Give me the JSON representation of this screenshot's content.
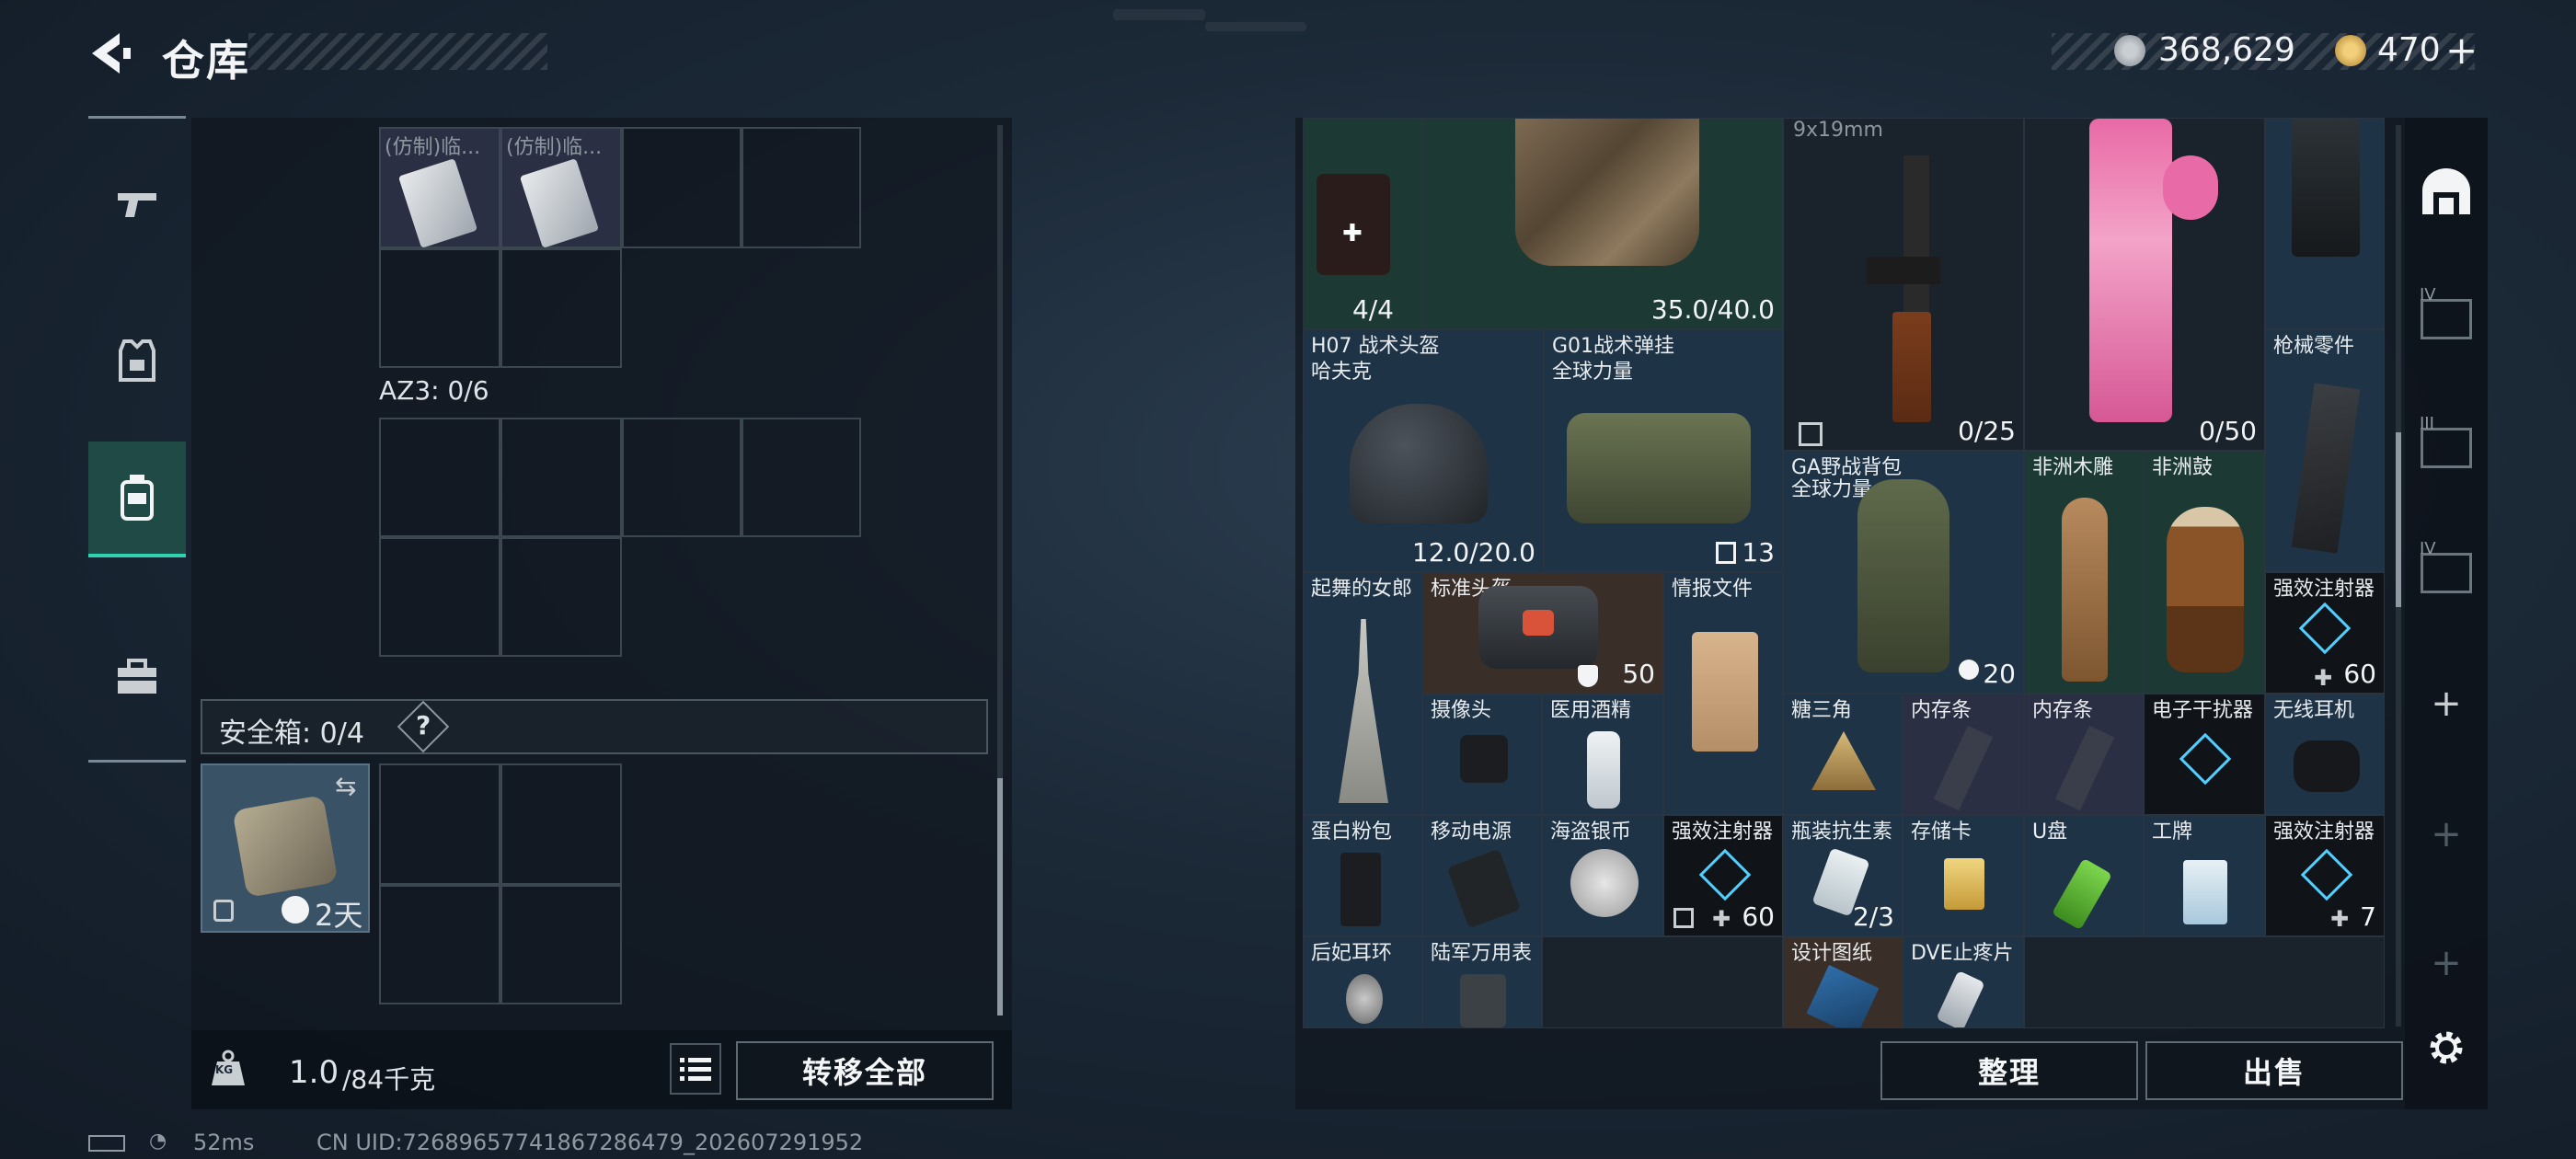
{
  "header": {
    "title": "仓库",
    "back_icon": "back-arrow-icon"
  },
  "currency": {
    "silver": "368,629",
    "gold": "470",
    "add": "+"
  },
  "rail": {
    "items": [
      {
        "icon": "gun-icon"
      },
      {
        "icon": "armor-icon"
      },
      {
        "icon": "backpack-icon"
      },
      {
        "icon": "toolbox-icon"
      }
    ]
  },
  "left": {
    "top_items": [
      {
        "label": "(仿制)临..."
      },
      {
        "label": "(仿制)临..."
      }
    ],
    "az3_label": "AZ3: 0/6",
    "safe_box": {
      "label": "安全箱: 0/4",
      "help": "?",
      "timer": "2天"
    },
    "weight": {
      "current": "1.0",
      "max": "/84千克",
      "icon_text": "KG"
    },
    "transfer_all": "转移全部"
  },
  "right": {
    "items": {
      "first_aid": {
        "value": "4/4"
      },
      "vest": {
        "value": "35.0/40.0"
      },
      "smg": {
        "caption": "9x19mm",
        "value": "0/25"
      },
      "pink_rifle": {
        "value": "0/50"
      },
      "helmet_h07": {
        "name": "H07 战术头盔",
        "sub": "哈夫克",
        "value": "12.0/20.0"
      },
      "g01_rig": {
        "name": "G01战术弹挂",
        "sub": "全球力量",
        "value": "13"
      },
      "ga_backpack": {
        "name": "GA野战背包",
        "sub": "全球力量",
        "value": "20"
      },
      "wood_carving": {
        "name": "非洲木雕"
      },
      "african_drum": {
        "name": "非洲鼓"
      },
      "gun_parts": {
        "name": "枪械零件"
      },
      "dancer": {
        "name": "起舞的女郎"
      },
      "standard_helmet": {
        "name": "标准头盔",
        "value": "50"
      },
      "intel_file": {
        "name": "情报文件"
      },
      "stim_1": {
        "name": "强效注射器",
        "value": "60"
      },
      "camera": {
        "name": "摄像头"
      },
      "alcohol": {
        "name": "医用酒精"
      },
      "sugar_triangle": {
        "name": "糖三角"
      },
      "ram_1": {
        "name": "内存条"
      },
      "ram_2": {
        "name": "内存条"
      },
      "jammer": {
        "name": "电子干扰器"
      },
      "earbuds": {
        "name": "无线耳机"
      },
      "protein": {
        "name": "蛋白粉包"
      },
      "power_bank": {
        "name": "移动电源"
      },
      "pirate_coin": {
        "name": "海盗银币"
      },
      "stim_2": {
        "name": "强效注射器",
        "value": "60"
      },
      "antibiotic": {
        "name": "瓶装抗生素",
        "value": "2/3"
      },
      "sd_card": {
        "name": "存储卡"
      },
      "usb": {
        "name": "U盘"
      },
      "badge": {
        "name": "工牌"
      },
      "stim_3": {
        "name": "强效注射器",
        "value": "7"
      },
      "earring": {
        "name": "后妃耳环"
      },
      "army_watch": {
        "name": "陆军万用表"
      },
      "blueprint": {
        "name": "设计图纸"
      },
      "dve_pill": {
        "name": "DVE止疼片"
      }
    },
    "sort_button": "整理",
    "sell_button": "出售"
  },
  "right_rail": {
    "items": [
      {
        "icon": "storage-tab-icon"
      },
      {
        "icon": "storage-iv-icon",
        "label": "IV"
      },
      {
        "icon": "storage-iii-icon",
        "label": "III"
      },
      {
        "icon": "storage-iv-folder-icon",
        "label": "IV"
      },
      {
        "icon": "plus-icon",
        "label": "+"
      },
      {
        "icon": "plus-icon",
        "label": "+"
      },
      {
        "icon": "plus-icon",
        "label": "+"
      }
    ],
    "settings_icon": "gear-icon"
  },
  "status": {
    "ping": "52ms",
    "uid": "CN UID:7268965774186728647​9_202607291952"
  }
}
